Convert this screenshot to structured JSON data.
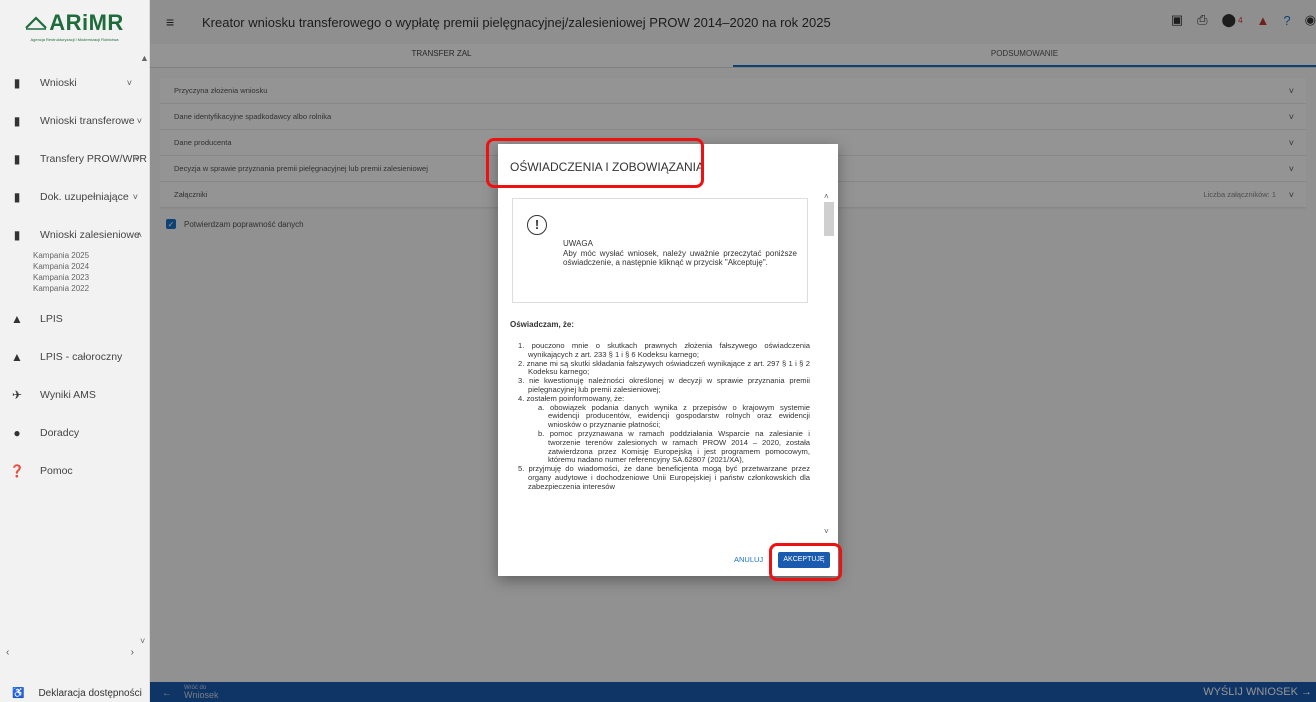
{
  "app": {
    "logo_text": "ARiMR",
    "logo_subtitle": "Agencja Restrukturyzacji i Modernizacji Rolnictwa",
    "title": "Kreator wniosku transferowego o wypłatę premii pielęgnacyjnej/zalesieniowej PROW 2014–2020 na rok 2025",
    "notification_count": "4"
  },
  "sidebar": {
    "items": [
      {
        "label": "Wnioski",
        "icon": "document-icon",
        "chevron": "˅"
      },
      {
        "label": "Wnioski transferowe",
        "icon": "document-icon",
        "chevron": "˅"
      },
      {
        "label": "Transfery PROW/WPR",
        "icon": "document-icon",
        "chevron": "˅"
      },
      {
        "label": "Dok. uzupełniające",
        "icon": "document-icon",
        "chevron": "˅"
      },
      {
        "label": "Wnioski zalesieniowe",
        "icon": "document-icon",
        "chevron": "˄"
      }
    ],
    "campaigns": [
      "Kampania 2025",
      "Kampania 2024",
      "Kampania 2023",
      "Kampania 2022"
    ],
    "items2": [
      {
        "label": "LPIS",
        "icon": "mountain-icon"
      },
      {
        "label": "LPIS - całoroczny",
        "icon": "mountain-icon"
      },
      {
        "label": "Wyniki AMS",
        "icon": "satellite-icon"
      },
      {
        "label": "Doradcy",
        "icon": "person-icon"
      },
      {
        "label": "Pomoc",
        "icon": "help-icon"
      }
    ],
    "footer": "Deklaracja dostępności"
  },
  "tabs": [
    "TRANSFER ZAL",
    "PODSUMOWANIE"
  ],
  "accordion": [
    {
      "label": "Przyczyna złożenia wniosku",
      "extra": ""
    },
    {
      "label": "Dane identyfikacyjne spadkodawcy albo rolnika",
      "extra": ""
    },
    {
      "label": "Dane producenta",
      "extra": ""
    },
    {
      "label": "Decyzja w sprawie przyznania premii pielęgnacyjnej lub premii zalesieniowej",
      "extra": ""
    },
    {
      "label": "Załączniki",
      "extra": "Liczba załączników: 1"
    }
  ],
  "confirm_label": "Potwierdzam poprawność danych",
  "bottom": {
    "back_line1": "Wróć do",
    "back_line2": "Wniosek",
    "send": "WYŚLIJ WNIOSEK"
  },
  "modal": {
    "title": "OŚWIADCZENIA I ZOBOWIĄZANIA",
    "warning_heading": "UWAGA",
    "warning_text": "Aby móc wysłać wniosek, należy uważnie przeczytać poniższe oświadczenie, a następnie kliknąć w przycisk \"Akceptuję\".",
    "declare_heading": "Oświadczam, że:",
    "points": [
      "1. pouczono mnie o skutkach prawnych złożenia fałszywego oświadczenia wynikających z art. 233 § 1 i § 6 Kodeksu karnego;",
      "2. znane mi są skutki składania fałszywych oświadczeń wynikające z art. 297 § 1 i § 2 Kodeksu karnego;",
      "3. nie kwestionuję należności określonej w decyzji w sprawie przyznania premii pielęgnacyjnej lub premii zalesieniowej;",
      "4. zostałem poinformowany, że:"
    ],
    "subpoints": [
      "a. obowiązek podania danych wynika z przepisów o krajowym systemie ewidencji producentów, ewidencji gospodarstw rolnych oraz ewidencji wniosków o przyznanie płatności;",
      "b. pomoc przyznawana w ramach poddziałania Wsparcie na zalesianie i tworzenie terenów zalesionych w ramach PROW 2014 – 2020, została zatwierdzona przez Komisję Europejską i jest programem pomocowym, któremu nadano numer referencyjny SA.62807 (2021/XA),"
    ],
    "point5": "5. przyjmuję do wiadomości, że dane beneficjenta mogą być przetwarzane przez organy audytowe i dochodzeniowe Unii Europejskiej i państw członkowskich dla zabezpieczenia interesów",
    "cancel": "ANULUJ",
    "accept": "AKCEPTUJĘ"
  }
}
